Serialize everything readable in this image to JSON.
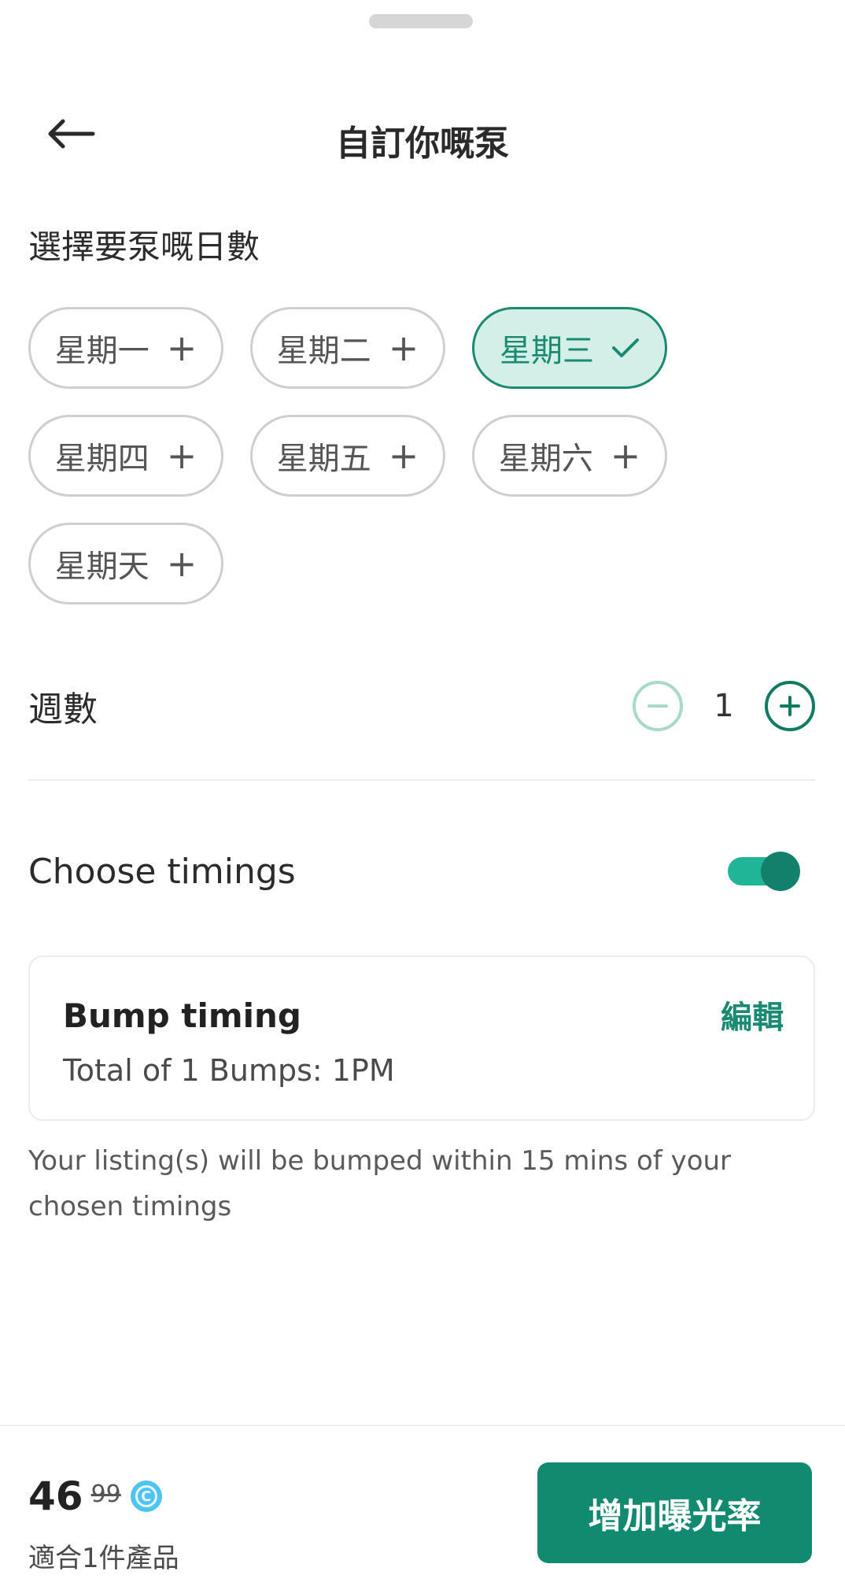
{
  "header": {
    "title": "自訂你嘅泵"
  },
  "days_section": {
    "label": "選擇要泵嘅日數",
    "days": [
      {
        "label": "星期一",
        "selected": false,
        "icon": "plus-icon"
      },
      {
        "label": "星期二",
        "selected": false,
        "icon": "plus-icon"
      },
      {
        "label": "星期三",
        "selected": true,
        "icon": "check-icon"
      },
      {
        "label": "星期四",
        "selected": false,
        "icon": "plus-icon"
      },
      {
        "label": "星期五",
        "selected": false,
        "icon": "plus-icon"
      },
      {
        "label": "星期六",
        "selected": false,
        "icon": "plus-icon"
      },
      {
        "label": "星期天",
        "selected": false,
        "icon": "plus-icon"
      }
    ]
  },
  "weeks": {
    "label": "週數",
    "value": "1"
  },
  "timings": {
    "label": "Choose timings",
    "enabled": true
  },
  "bump_card": {
    "title": "Bump timing",
    "subtitle": "Total of 1 Bumps: 1PM",
    "edit_label": "編輯"
  },
  "note": "Your listing(s) will be bumped within 15 mins of your chosen timings",
  "footer": {
    "price": "46",
    "original_price": "99",
    "applies_to": "適合1件產品",
    "cta_label": "增加曝光率"
  },
  "colors": {
    "accent": "#128a70",
    "accent_light": "#d3efe8",
    "toggle_track": "#20b596",
    "coin": "#4fc4f2"
  }
}
